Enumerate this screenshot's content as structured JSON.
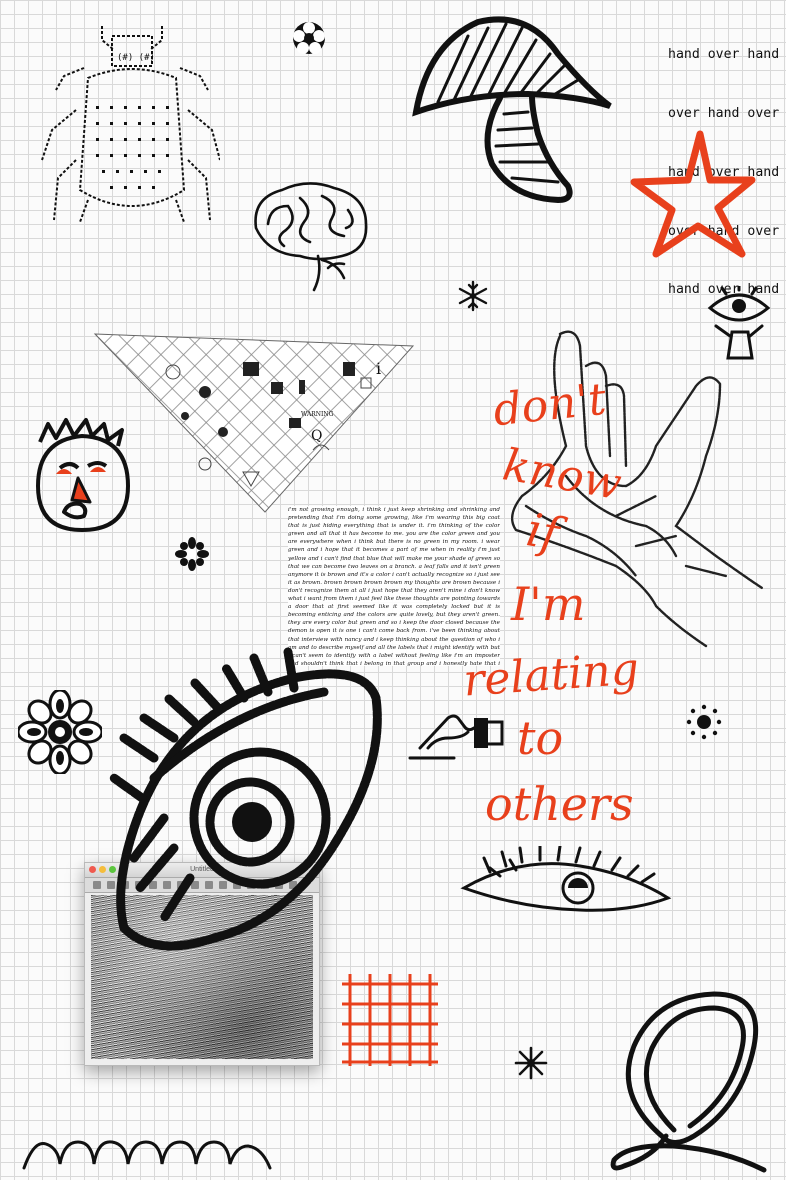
{
  "hand_over_lines": [
    "hand over hand",
    "over hand over",
    "hand over hand",
    "over hand over",
    "hand over hand"
  ],
  "script_words": [
    "don't",
    "know",
    "if",
    "I'm",
    "relating",
    "to",
    "others"
  ],
  "essay_text": "i'm not growing enough, i think i just keep shrinking and shrinking and pretending that i'm doing some growing, like i'm wearing this big coat that is just hiding everything that is under it. i'm thinking of the color green and all that it has become to me. you are the color green and you are everywhere when i think but there is no green in my room. i wear green and i hope that it becomes a part of me when in reality i'm just yellow and i can't find that blue that will make me your shade of green so that we can become two leaves on a branch. a leaf falls and it isn't green anymore it is brown and it's a color i can't actually recognize so i just see it as brown. brown brown brown brown my thoughts are brown because i don't recognize them at all i just hope that they aren't mine i don't know what i want from them i just feel like these thoughts are pointing towards a door that at first seemed like it was completely locked but it is becoming enticing and the colors are quite lovely, but they aren't green. they are every color but green and so i keep the door closed because the demon is open it is one i can't come back from. i've been thinking about that interview with nancy and i keep thinking about the question of who i am and to describe myself and all the labels that i might identify with but i can't seem to identify with a label without feeling like i'm an imposter and shouldn't think that i belong in that group and i honestly hate that i hate the emotions that come with imitation and feeling like there is someone that you have to be and trying to be that person all the time without really knowing who you are as an individual, you know?",
  "mac_window": {
    "title": "Untitled"
  },
  "colors": {
    "accent": "#e8401c",
    "ink": "#111111",
    "grid": "#d9d9d9"
  },
  "icons": [
    "ascii-beetle",
    "flower-stamp-icon",
    "mushroom-drawing",
    "red-star-outline",
    "brain-drawing",
    "snowflake-icon",
    "eye-figure-icon",
    "tiled-triangle-collage",
    "face-drawing",
    "asterisk-flower-icon",
    "writing-hand-icon",
    "dotted-circle-icon",
    "flower-icon",
    "crayon-eye-drawing",
    "line-eye-drawing",
    "red-grid-icon",
    "snowflake-small-icon",
    "script-q-letter",
    "wavy-line",
    "crayon-hand-drawing"
  ]
}
